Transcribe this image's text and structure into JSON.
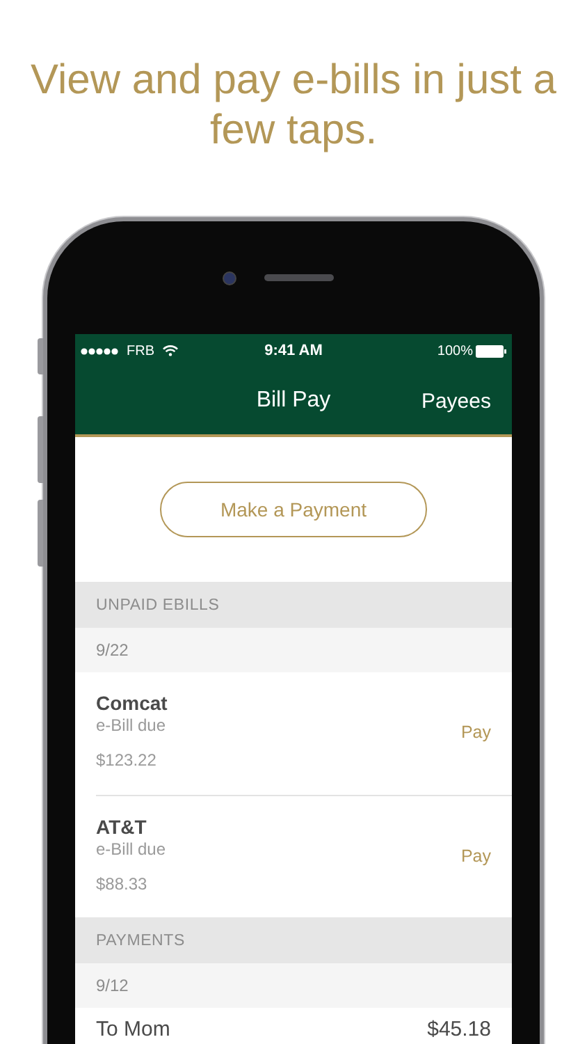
{
  "headline": "View and pay e-bills in just a few taps.",
  "status_bar": {
    "carrier": "FRB",
    "time": "9:41 AM",
    "battery": "100%"
  },
  "nav": {
    "title": "Bill Pay",
    "action": "Payees"
  },
  "primary_button": "Make a Payment",
  "sections": [
    {
      "title": "UNPAID EBILLS",
      "groups": [
        {
          "date": "9/22",
          "items": [
            {
              "kind": "ebill",
              "payee": "Comcat",
              "status": "e-Bill due",
              "amount": "$123.22",
              "action": "Pay"
            },
            {
              "kind": "ebill",
              "payee": "AT&T",
              "status": "e-Bill due",
              "amount": "$88.33",
              "action": "Pay"
            }
          ]
        }
      ]
    },
    {
      "title": "PAYMENTS",
      "groups": [
        {
          "date": "9/12",
          "items": [
            {
              "kind": "payment",
              "payee": "To Mom",
              "amount": "$45.18"
            }
          ]
        }
      ]
    }
  ]
}
